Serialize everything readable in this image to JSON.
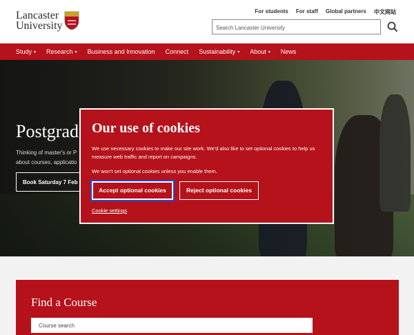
{
  "header": {
    "logo": {
      "line1": "Lancaster",
      "line2": "University"
    },
    "top_links": [
      "For students",
      "For staff",
      "Global partners",
      "中文网站"
    ],
    "search": {
      "placeholder": "Search Lancaster University"
    }
  },
  "nav": {
    "items": [
      {
        "label": "Study",
        "dropdown": true
      },
      {
        "label": "Research",
        "dropdown": true
      },
      {
        "label": "Business and Innovation",
        "dropdown": false
      },
      {
        "label": "Connect",
        "dropdown": false
      },
      {
        "label": "Sustainability",
        "dropdown": true
      },
      {
        "label": "About",
        "dropdown": true
      },
      {
        "label": "News",
        "dropdown": false
      }
    ],
    "caret": "▾"
  },
  "hero": {
    "title": "Postgrad",
    "text": "Thinking of master's or P about courses, applicatio",
    "button": "Book Saturday 7 Feb"
  },
  "find_course": {
    "title": "Find a Course",
    "search_placeholder": "Course search"
  },
  "cookie_modal": {
    "title": "Our use of cookies",
    "paragraph1": "We use necessary cookies to make our site work. We'd also like to set optional cookies to help us measure web traffic and report on campaigns.",
    "paragraph2": "We won't set optional cookies unless you enable them.",
    "accept_label": "Accept optional cookies",
    "reject_label": "Reject optional cookies",
    "settings_label": "Cookie settings"
  },
  "colors": {
    "brand_red": "#b5121b",
    "focus_ring": "#1a4bd6"
  }
}
